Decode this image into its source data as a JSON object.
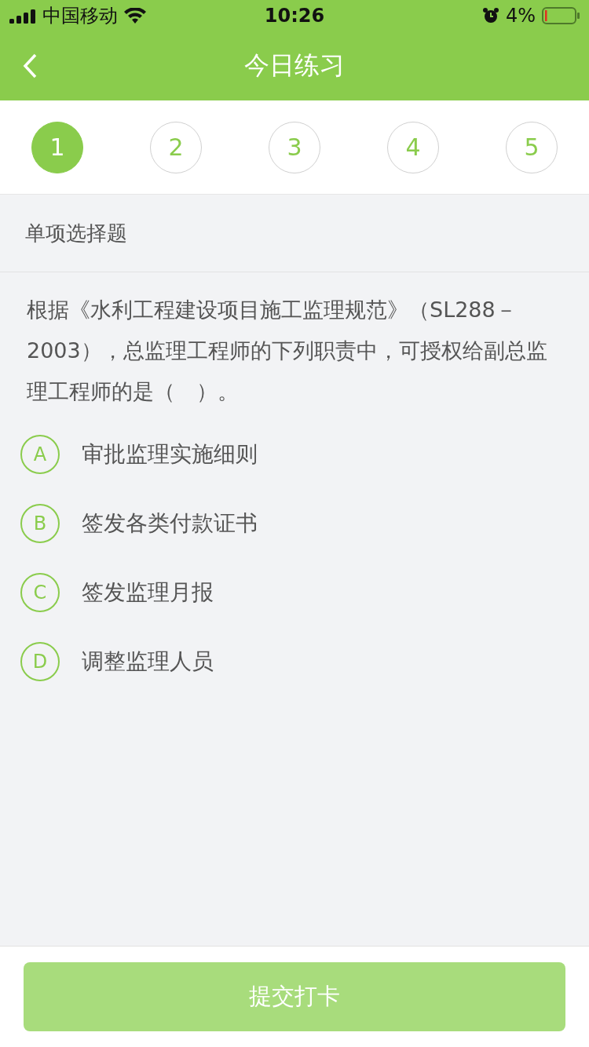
{
  "status_bar": {
    "carrier": "中国移动",
    "time": "10:26",
    "battery": "4%"
  },
  "header": {
    "title": "今日练习"
  },
  "steps": [
    {
      "label": "1",
      "selected": true
    },
    {
      "label": "2",
      "selected": false
    },
    {
      "label": "3",
      "selected": false
    },
    {
      "label": "4",
      "selected": false
    },
    {
      "label": "5",
      "selected": false
    }
  ],
  "section": "单项选择题",
  "question": "根据《水利工程建设项目施工监理规范》（SL288－2003），总监理工程师的下列职责中，可授权给副总监理工程师的是（　）。",
  "options": [
    {
      "letter": "A",
      "text": "审批监理实施细则",
      "selected": false
    },
    {
      "letter": "B",
      "text": "签发各类付款证书",
      "selected": false
    },
    {
      "letter": "C",
      "text": "签发监理月报",
      "selected": false
    },
    {
      "letter": "D",
      "text": "调整监理人员",
      "selected": false
    }
  ],
  "submit": {
    "label": "提交打卡",
    "disabled": true
  }
}
